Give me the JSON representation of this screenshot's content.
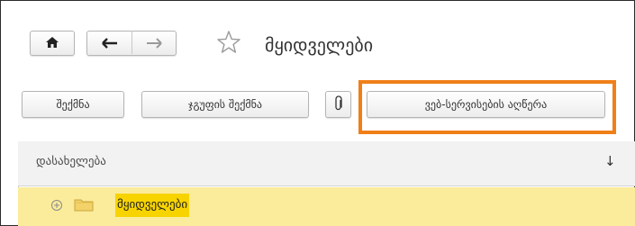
{
  "window": {
    "title": "მყიდველები"
  },
  "toolbar": {
    "create_label": "შექმნა",
    "create_group_label": "ჯგუფის შექმნა",
    "web_services_label": "ვებ-სერვისების აღწერა"
  },
  "table": {
    "column_header": "დასახელება",
    "sort_indicator": "↓",
    "rows": [
      {
        "label": "მყიდველები",
        "expand_icon": "⊕"
      }
    ]
  },
  "colors": {
    "highlight_border": "#f07f18",
    "selected_row_bg": "#fbec9b",
    "selected_label_bg": "#f7d400",
    "folder_icon": "#f3d26a"
  },
  "icons": {
    "home": "home-icon",
    "back": "back-arrow-icon",
    "forward": "forward-arrow-icon",
    "favorite": "star-outline-icon",
    "attach": "paperclip-icon",
    "expand": "expand-plus-icon",
    "folder": "folder-icon"
  }
}
